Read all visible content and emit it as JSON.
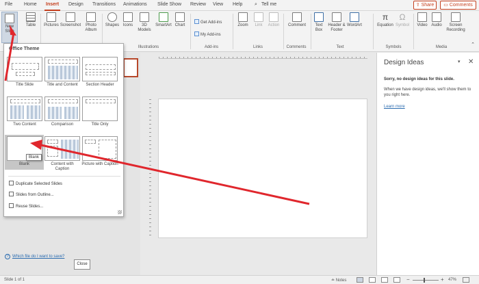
{
  "menu": {
    "tabs": [
      "File",
      "Home",
      "Insert",
      "Design",
      "Transitions",
      "Animations",
      "Slide Show",
      "Review",
      "View",
      "Help"
    ],
    "search": "Tell me",
    "share": "Share",
    "comments": "Comments"
  },
  "ribbon": {
    "new_slide": "New Slide",
    "table": "Table",
    "pictures": "Pictures",
    "screenshot": "Screenshot",
    "photo_album": "Photo Album",
    "shapes": "Shapes",
    "icons": "Icons",
    "models": "3D Models",
    "smartart": "SmartArt",
    "chart": "Chart",
    "get_addins": "Get Add-ins",
    "my_addins": "My Add-ins",
    "zoom": "Zoom",
    "link": "Link",
    "action": "Action",
    "comment": "Comment",
    "textbox": "Text Box",
    "header_footer": "Header & Footer",
    "wordart": "WordArt",
    "equation": "Equation",
    "symbol": "Symbol",
    "video": "Video",
    "audio": "Audio",
    "screen_recording": "Screen Recording",
    "groups": {
      "illustrations": "Illustrations",
      "addins": "Add-ins",
      "links": "Links",
      "comments": "Comments",
      "text": "Text",
      "symbols": "Symbols",
      "media": "Media"
    }
  },
  "dropdown": {
    "header": "Office Theme",
    "layouts": [
      {
        "label": "Title Slide"
      },
      {
        "label": "Title and Content"
      },
      {
        "label": "Section Header"
      },
      {
        "label": "Two Content"
      },
      {
        "label": "Comparison"
      },
      {
        "label": "Title Only"
      },
      {
        "label": "Blank"
      },
      {
        "label": "Content with Caption"
      },
      {
        "label": "Picture with Caption"
      }
    ],
    "tooltip": "Blank",
    "commands": [
      "Duplicate Selected Slides",
      "Slides from Outline...",
      "Reuse Slides..."
    ]
  },
  "design_ideas": {
    "title": "Design Ideas",
    "sorry": "Sorry, no design ideas for this slide.",
    "desc": "When we have design ideas, we'll show them to you right here.",
    "learn_more": "Learn more"
  },
  "help_link": "Which file do I want to save?",
  "close": "Close",
  "status": {
    "slide": "Slide 1 of 1",
    "notes": "Notes",
    "zoom": "47%"
  },
  "colors": {
    "accent": "#c43e1c",
    "arrow": "#e0272d"
  }
}
